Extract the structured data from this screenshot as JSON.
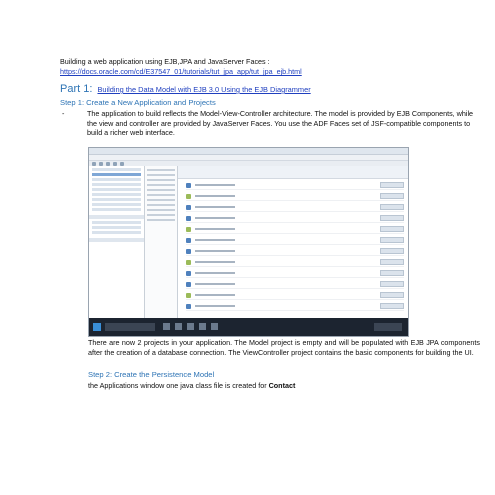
{
  "intro": {
    "line": "Building a web application using EJB,JPA and JavaServer Faces :",
    "url": "https://docs.oracle.com/cd/E37547_01/tutorials/tut_jpa_app/tut_jpa_ejb.html"
  },
  "part1": {
    "label": "Part 1:",
    "link": "Building the Data Model with EJB 3.0 Using the EJB Diagrammer"
  },
  "step1": {
    "heading": "Step 1: Create a New Application and Projects",
    "bullet": "-",
    "text": "The application to build reflects the Model-View-Controller architecture. The model is provided by EJB Components, while the view and controller are provided by JavaServer Faces. You use the ADF Faces set of JSF-compatible components to build a richer web interface."
  },
  "after_screenshot": "There are now 2 projects in your application. The Model project is empty and will be populated with EJB JPA components after the creation of a database connection. The ViewController project contains the basic components for building the UI.",
  "step2": {
    "heading": "Step 2: Create the Persistence Model",
    "text_prefix": "the Applications window one java class file is created for",
    "text_bold": "Contact"
  }
}
